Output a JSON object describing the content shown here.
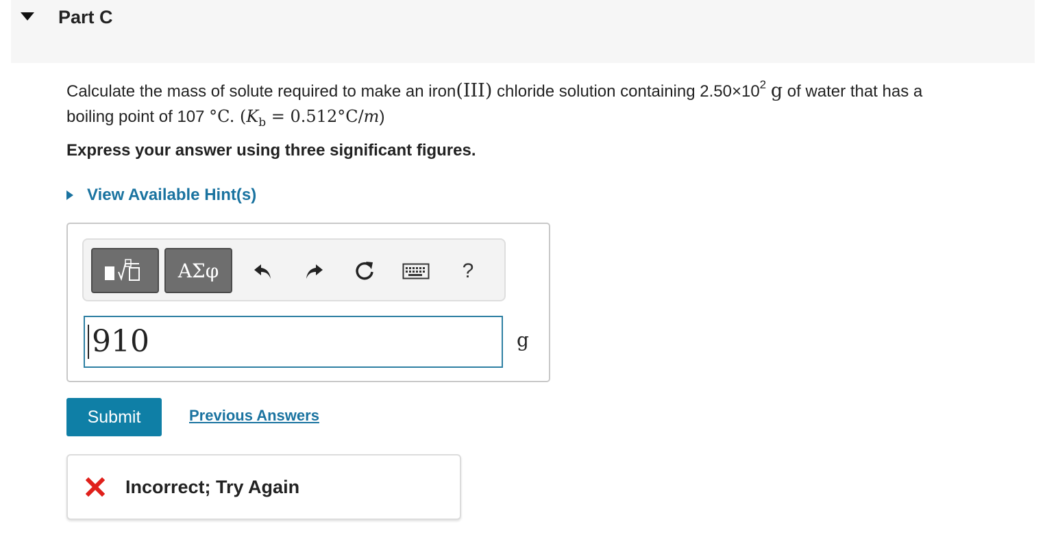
{
  "part": {
    "title": "Part C"
  },
  "question": {
    "text_before_iron": "Calculate the mass of solute required to make an iron",
    "iron_roman": "(III)",
    "text_after_iron": " chloride solution containing 2.50×10",
    "exponent": "2",
    "unit_g": "g",
    "text_after_unit": " of water that has a",
    "line2_text": "boiling point of 107 ",
    "degree_c": "°C",
    "kb_open": ". (",
    "kb_symbol": "K",
    "kb_subscript": "b",
    "kb_equals": " = 0.512°C/",
    "kb_m": "m",
    "kb_close": ")"
  },
  "instruction": "Express your answer using three significant figures.",
  "hint": {
    "label": "View Available Hint(s)"
  },
  "toolbar": {
    "templates_icon": "templates-icon",
    "greek_label": "ΑΣφ",
    "undo_icon": "undo-icon",
    "redo_icon": "redo-icon",
    "reset_icon": "reset-icon",
    "keyboard_icon": "keyboard-icon",
    "help_label": "?"
  },
  "answer": {
    "value": "910",
    "unit": "g"
  },
  "submit": {
    "label": "Submit"
  },
  "previous_answers": {
    "label": "Previous Answers"
  },
  "feedback": {
    "text": "Incorrect; Try Again",
    "status_color": "#e0201b"
  },
  "colors": {
    "accent": "#0f7fa6",
    "link": "#1a73a0",
    "error": "#e0201b",
    "header_bg": "#f6f6f6"
  }
}
